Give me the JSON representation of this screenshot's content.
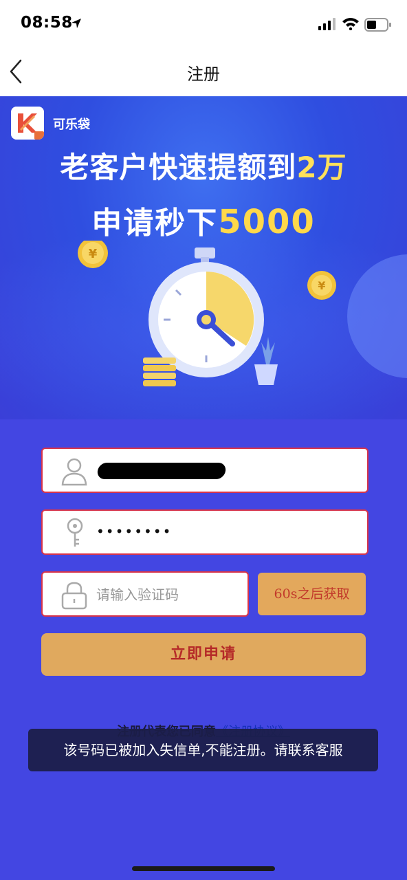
{
  "status_bar": {
    "time": "08:58",
    "icons": [
      "location-arrow-icon",
      "signal-icon",
      "wifi-icon",
      "battery-icon"
    ]
  },
  "nav": {
    "title": "注册",
    "back_icon": "chevron-left-icon"
  },
  "banner": {
    "app_name": "可乐袋",
    "headline_prefix": "老客户快速提额到",
    "headline_highlight": "2万",
    "subline_prefix": "申请秒下",
    "subline_highlight": "5000",
    "coin_symbol": "¥",
    "colors": {
      "background": "#3a4fe0",
      "highlight": "#ffd84a"
    }
  },
  "form": {
    "phone": {
      "icon": "user-icon",
      "value_redacted": true
    },
    "password": {
      "icon": "key-icon",
      "value": "••••••••"
    },
    "verify_code": {
      "icon": "lock-icon",
      "placeholder": "请输入验证码"
    },
    "get_code_button": "60s之后获取",
    "submit_button": "立即申请",
    "agreement_text": "注册代表您已同意",
    "agreement_link": "《注册协议》",
    "colors": {
      "background": "#4346e2",
      "button": "#e0a95e",
      "button_text": "#b52a28",
      "field_border": "#d8344a"
    }
  },
  "toast": {
    "message": "该号码已被加入失信单,不能注册。请联系客服"
  }
}
